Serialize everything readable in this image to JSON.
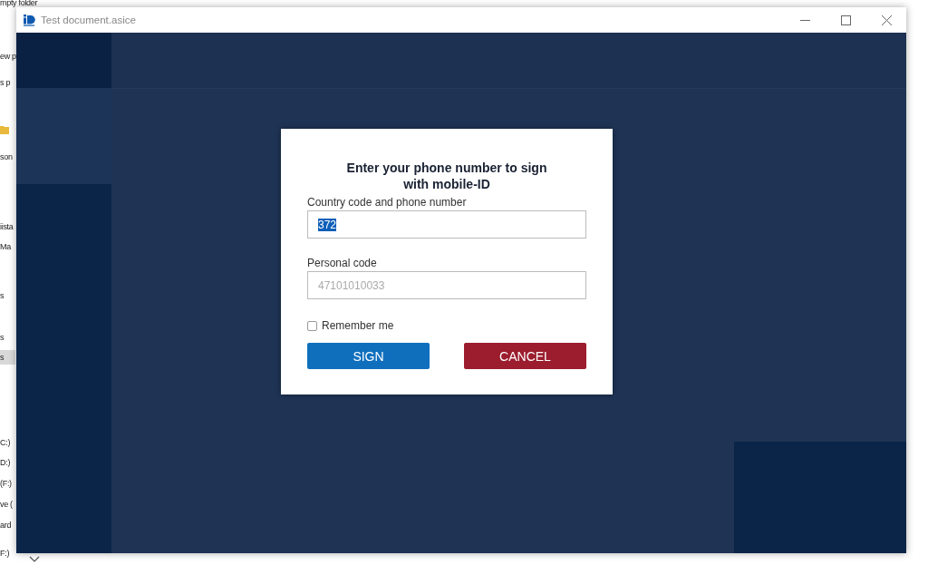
{
  "background_explorer": {
    "items": [
      {
        "label": "mpty folder",
        "selected": false
      },
      {
        "label": "ew p",
        "selected": false
      },
      {
        "label": "s p",
        "selected": false
      },
      {
        "label": "son",
        "selected": false
      },
      {
        "label": "iista",
        "selected": false
      },
      {
        "label": "Ma",
        "selected": false
      },
      {
        "label": "s",
        "selected": false
      },
      {
        "label": "s",
        "selected": false
      },
      {
        "label": "s",
        "selected": true
      },
      {
        "label": "C:)",
        "selected": false
      },
      {
        "label": "D:)",
        "selected": false
      },
      {
        "label": "(F:)",
        "selected": false
      },
      {
        "label": "ve (",
        "selected": false
      },
      {
        "label": "ard",
        "selected": false
      },
      {
        "label": "F:)",
        "selected": false
      }
    ]
  },
  "window": {
    "title": "Test document.asice"
  },
  "dialog": {
    "title": "Enter your phone number to sign with mobile-ID",
    "phone_field": {
      "label": "Country code and phone number",
      "value": "372",
      "text_selected": true
    },
    "personal_code_field": {
      "label": "Personal code",
      "placeholder": "47101010033"
    },
    "remember_me": {
      "label": "Remember me",
      "checked": false
    },
    "buttons": [
      {
        "label": "SIGN",
        "kind": "primary"
      },
      {
        "label": "CANCEL",
        "kind": "danger"
      }
    ]
  }
}
